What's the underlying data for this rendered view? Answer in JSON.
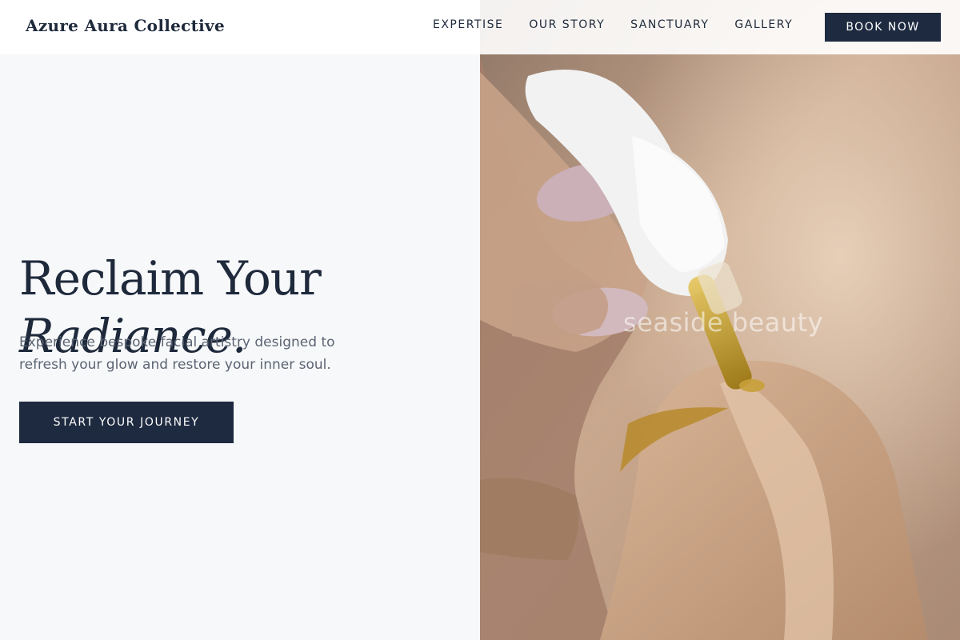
{
  "brand": {
    "name": "Azure Aura Collective"
  },
  "nav": {
    "items": [
      {
        "label": "EXPERTISE"
      },
      {
        "label": "OUR STORY"
      },
      {
        "label": "SANCTUARY"
      },
      {
        "label": "GALLERY"
      }
    ],
    "cta_label": "BOOK NOW"
  },
  "hero": {
    "headline_line1": "Reclaim Your",
    "headline_line2": "Radiance.",
    "subtext": "Experience bespoke facial artistry designed to refresh your glow and restore your inner soul.",
    "cta_label": "START YOUR JOURNEY",
    "image_watermark": "seaside beauty"
  },
  "colors": {
    "primary": "#1e2a40",
    "text": "#1e293b",
    "muted": "#5b6472",
    "background": "#f7f8fa"
  }
}
